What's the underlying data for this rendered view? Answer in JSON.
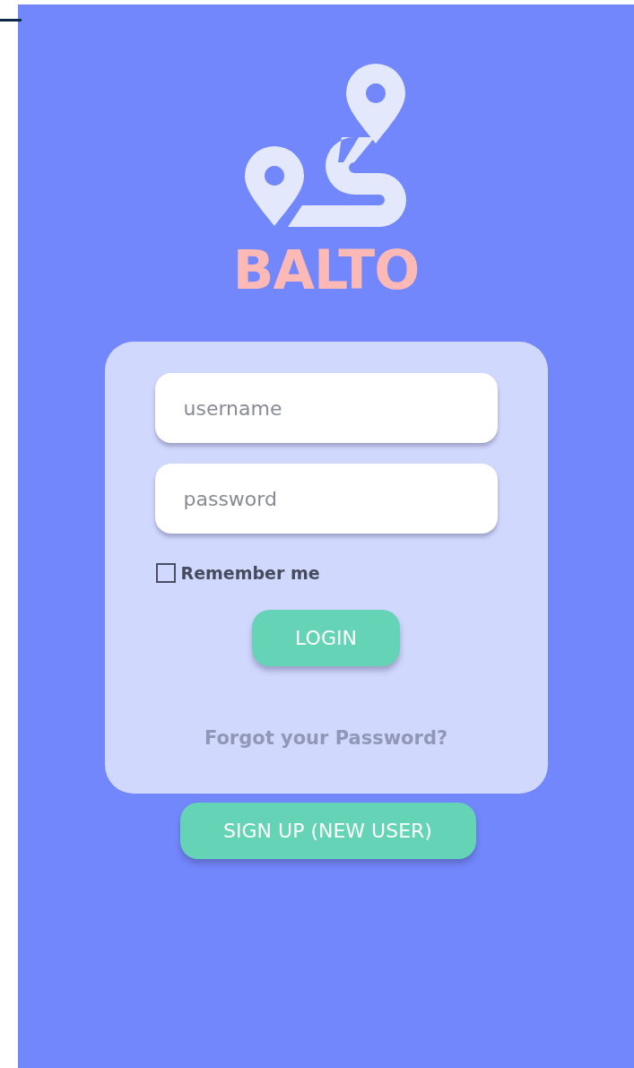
{
  "app": {
    "name": "BALTO"
  },
  "login_form": {
    "username": {
      "placeholder": "username"
    },
    "password": {
      "placeholder": "password"
    },
    "remember_me": {
      "label": "Remember me",
      "checked": false
    },
    "login_button": "LOGIN",
    "forgot_link": "Forgot your Password?"
  },
  "signup_button": "SIGN UP (NEW USER)"
}
